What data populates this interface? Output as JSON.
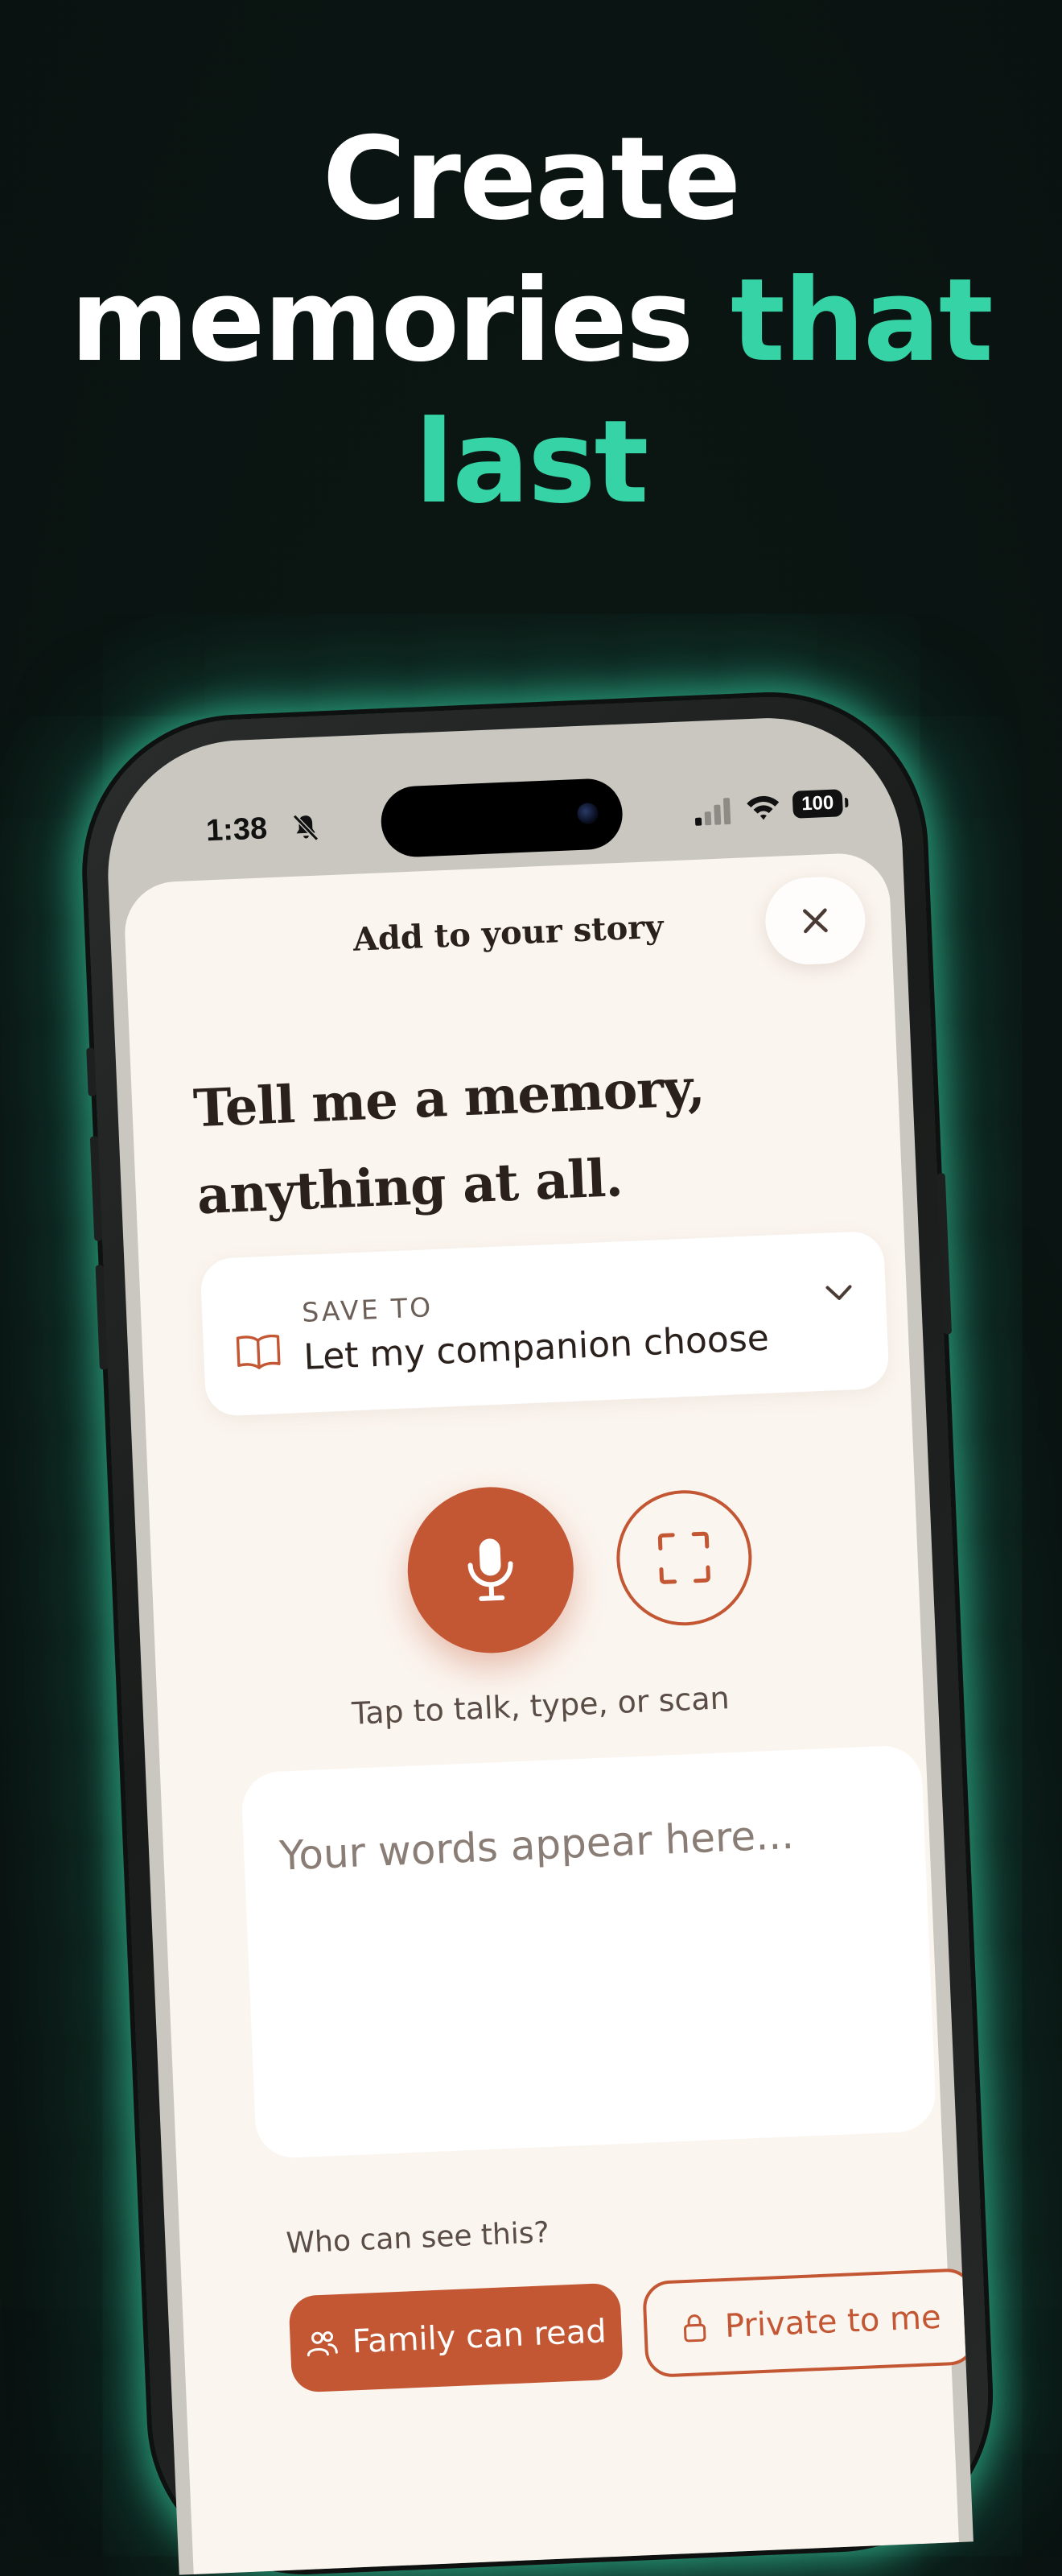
{
  "headline": {
    "line1": "Create",
    "line2_white": "memories",
    "line2_accent": "that",
    "line3_accent": "last"
  },
  "status_bar": {
    "time": "1:38",
    "battery": "100"
  },
  "sheet": {
    "title": "Add to your story",
    "prompt_line1": "Tell me a memory,",
    "prompt_line2": "anything at all."
  },
  "save_to": {
    "label": "SAVE TO",
    "value": "Let my companion choose"
  },
  "hint": "Tap to talk, type, or scan",
  "text_area": {
    "placeholder": "Your words appear here..."
  },
  "visibility": {
    "label": "Who can see this?",
    "options": [
      {
        "label": "Family can read",
        "icon": "people-icon",
        "selected": true
      },
      {
        "label": "Private to me",
        "icon": "lock-icon",
        "selected": false
      }
    ]
  },
  "colors": {
    "background": "#0b1613",
    "accent_green": "#35d3a5",
    "brand_terracotta": "#c35633",
    "sheet_bg": "#fbf5ef"
  }
}
